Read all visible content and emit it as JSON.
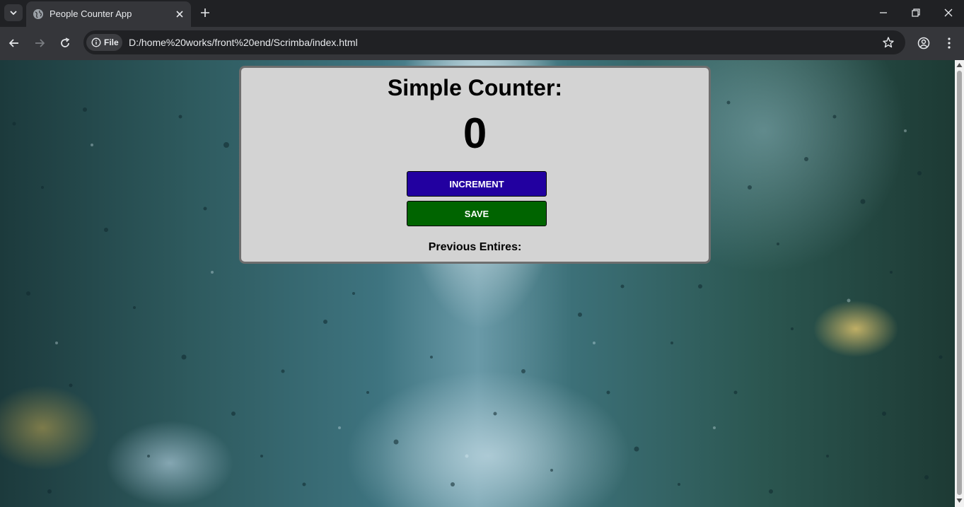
{
  "browser": {
    "tab_title": "People Counter App",
    "address_chip": "File",
    "url": "D:/home%20works/front%20end/Scrimba/index.html"
  },
  "page": {
    "title": "Simple Counter:",
    "count": "0",
    "increment_label": "INCREMENT",
    "save_label": "SAVE",
    "previous_label": "Previous Entires:"
  },
  "colors": {
    "increment_button": "#2200a0",
    "save_button": "#006400",
    "card_background": "#d3d3d3"
  },
  "icons": [
    "tab-search-icon",
    "globe-icon",
    "close-icon",
    "plus-icon",
    "minimize-icon",
    "restore-icon",
    "window-close-icon",
    "back-arrow-icon",
    "forward-arrow-icon",
    "reload-icon",
    "info-icon",
    "star-icon",
    "profile-icon",
    "kebab-menu-icon"
  ]
}
